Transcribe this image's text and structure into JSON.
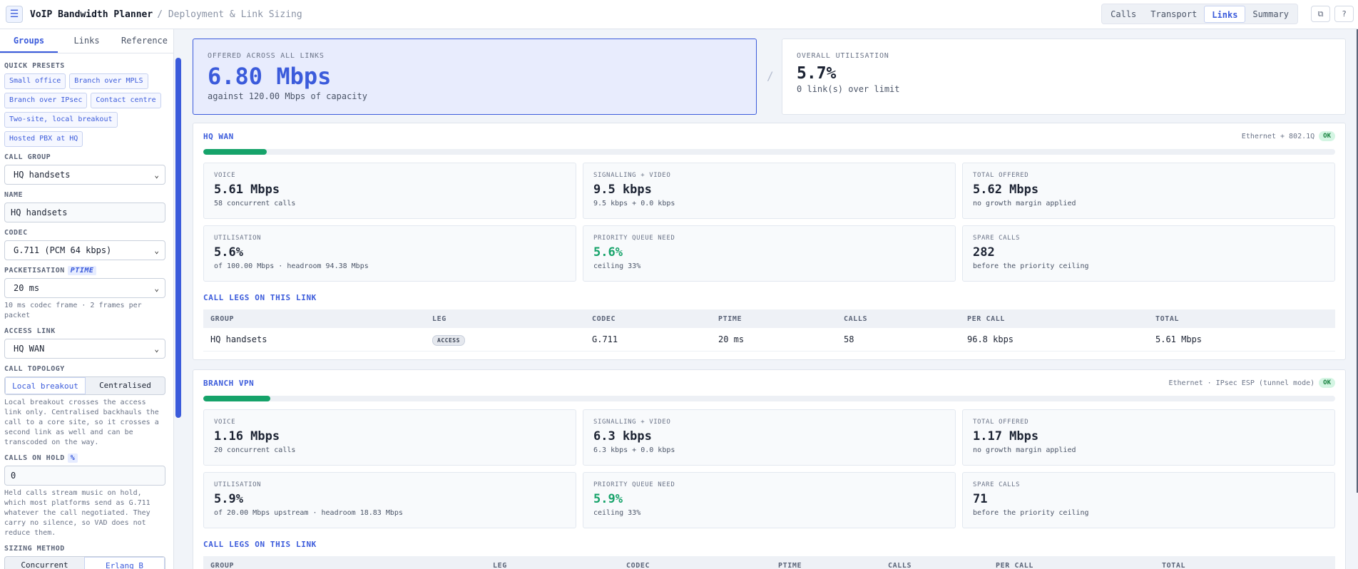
{
  "header": {
    "menu_icon": "hamburger-icon",
    "title": "VoIP Bandwidth Planner",
    "subtitle": "/ Deployment & Link Sizing",
    "tabs": [
      "Calls",
      "Transport",
      "Links",
      "Summary"
    ],
    "active_tab": "Links"
  },
  "sidebar": {
    "tabs": [
      "Groups",
      "Links",
      "Reference"
    ],
    "active_tab": "Groups",
    "quick_presets_label": "Quick presets",
    "presets": [
      "Small office",
      "Branch over MPLS",
      "Branch over IPsec",
      "Contact centre",
      "Two-site, local breakout",
      "Hosted PBX at HQ"
    ],
    "call_group_label": "Call group",
    "call_group_value": "HQ handsets",
    "name_label": "Name",
    "name_value": "HQ handsets",
    "codec_label": "Codec",
    "codec_value": "G.711 (PCM 64 kbps)",
    "packetisation_label": "Packetisation",
    "packetisation_tag": "ptime",
    "packetisation_value": "20 ms",
    "packetisation_hint": "10 ms codec frame · 2 frames per packet",
    "access_link_label": "Access link",
    "access_link_value": "HQ WAN",
    "topology_label": "Call topology",
    "topology_options": [
      "Local breakout",
      "Centralised"
    ],
    "topology_active": "Local breakout",
    "topology_hint": "Local breakout crosses the access link only. Centralised backhauls the call to a core site, so it crosses a second link as well and can be transcoded on the way.",
    "hold_label": "Calls on hold",
    "hold_unit": "%",
    "hold_value": "0",
    "hold_hint": "Held calls stream music on hold, which most platforms send as G.711 whatever the call negotiated. They carry no silence, so VAD does not reduce them.",
    "sizing_label": "Sizing method",
    "sizing_options": [
      "Concurrent",
      "Erlang B"
    ],
    "sizing_active": "Erlang B"
  },
  "summary": {
    "offered_label": "Offered across all links",
    "offered_value": "6.80 Mbps",
    "offered_sub": "against 120.00 Mbps of capacity",
    "separator": "/",
    "util_label": "Overall utilisation",
    "util_value": "5.7%",
    "util_sub": "0 link(s) over limit"
  },
  "links": [
    {
      "name": "HQ WAN",
      "meta": "Ethernet + 802.1Q",
      "status": "OK",
      "utilisation_fraction": 0.056,
      "metrics": [
        {
          "label": "Voice",
          "value": "5.61 Mbps",
          "sub": "58 concurrent calls",
          "accent": false
        },
        {
          "label": "Signalling + video",
          "value": "9.5 kbps",
          "sub": "9.5 kbps + 0.0 kbps",
          "accent": false
        },
        {
          "label": "Total offered",
          "value": "5.62 Mbps",
          "sub": "no growth margin applied",
          "accent": false
        },
        {
          "label": "Utilisation",
          "value": "5.6%",
          "sub": "of 100.00 Mbps · headroom 94.38 Mbps",
          "accent": false
        },
        {
          "label": "Priority queue need",
          "value": "5.6%",
          "sub": "ceiling 33%",
          "accent": true
        },
        {
          "label": "Spare calls",
          "value": "282",
          "sub": "before the priority ceiling",
          "accent": false
        }
      ],
      "legs_title": "Call legs on this link",
      "columns": [
        "Group",
        "Leg",
        "Codec",
        "Ptime",
        "Calls",
        "Per call",
        "Total"
      ],
      "rows": [
        {
          "group": "HQ handsets",
          "leg": "ACCESS",
          "codec": "G.711",
          "ptime": "20 ms",
          "calls": "58",
          "per_call": "96.8 kbps",
          "total": "5.61 Mbps"
        }
      ]
    },
    {
      "name": "Branch VPN",
      "meta": "Ethernet · IPsec ESP (tunnel mode)",
      "status": "OK",
      "utilisation_fraction": 0.059,
      "metrics": [
        {
          "label": "Voice",
          "value": "1.16 Mbps",
          "sub": "20 concurrent calls",
          "accent": false
        },
        {
          "label": "Signalling + video",
          "value": "6.3 kbps",
          "sub": "6.3 kbps + 0.0 kbps",
          "accent": false
        },
        {
          "label": "Total offered",
          "value": "1.17 Mbps",
          "sub": "no growth margin applied",
          "accent": false
        },
        {
          "label": "Utilisation",
          "value": "5.9%",
          "sub": "of 20.00 Mbps upstream · headroom 18.83 Mbps",
          "accent": false
        },
        {
          "label": "Priority queue need",
          "value": "5.9%",
          "sub": "ceiling 33%",
          "accent": true
        },
        {
          "label": "Spare calls",
          "value": "71",
          "sub": "before the priority ceiling",
          "accent": false
        }
      ],
      "legs_title": "Call legs on this link",
      "columns": [
        "Group",
        "Leg",
        "Codec",
        "Ptime",
        "Calls",
        "Per call",
        "Total"
      ],
      "rows": []
    }
  ],
  "colors": {
    "accent": "#3b5bdb",
    "ok": "#16a36a"
  }
}
